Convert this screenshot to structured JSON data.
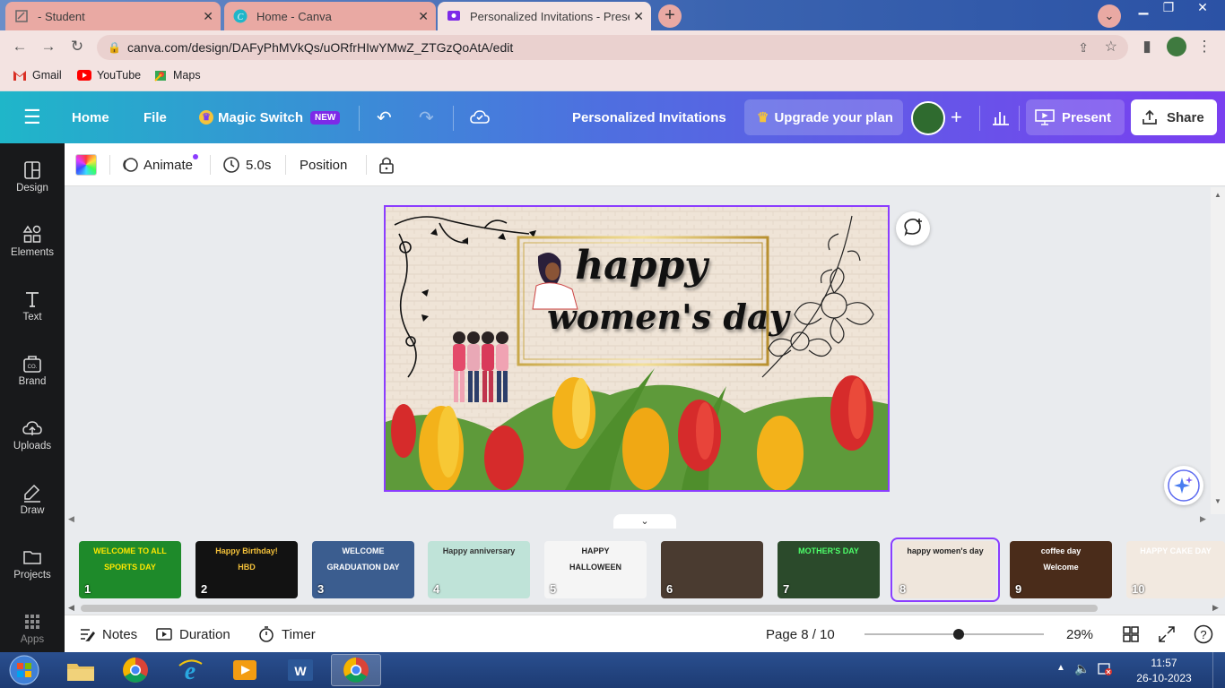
{
  "browser": {
    "tabs": [
      {
        "title": "- Student",
        "active": false
      },
      {
        "title": "Home - Canva",
        "active": false
      },
      {
        "title": "Personalized Invitations - Present",
        "active": true
      }
    ],
    "new_tab": "+",
    "url": "canva.com/design/DAFyPhMVkQs/uORfrHIwYMwZ_ZTGzQoAtA/edit",
    "bookmarks": [
      "Gmail",
      "YouTube",
      "Maps"
    ]
  },
  "header": {
    "home": "Home",
    "file": "File",
    "magic_switch": "Magic Switch",
    "magic_badge": "NEW",
    "doc_title": "Personalized Invitations",
    "upgrade": "Upgrade your plan",
    "present": "Present",
    "share": "Share"
  },
  "rail": [
    {
      "label": "Design",
      "icon": "layout-icon"
    },
    {
      "label": "Elements",
      "icon": "shapes-icon"
    },
    {
      "label": "Text",
      "icon": "text-icon"
    },
    {
      "label": "Brand",
      "icon": "brand-icon"
    },
    {
      "label": "Uploads",
      "icon": "cloud-upload-icon"
    },
    {
      "label": "Draw",
      "icon": "pen-icon"
    },
    {
      "label": "Projects",
      "icon": "folder-icon"
    },
    {
      "label": "Apps",
      "icon": "grid-icon"
    }
  ],
  "context_toolbar": {
    "animate": "Animate",
    "duration": "5.0s",
    "position": "Position"
  },
  "slide": {
    "line1": "happy",
    "line2": "women's day"
  },
  "filmstrip": [
    {
      "num": "1",
      "text": "WELCOME TO ALL",
      "sub": "SPORTS DAY",
      "bg": "#1e8a2a",
      "fg": "#ffe600"
    },
    {
      "num": "2",
      "text": "Happy Birthday!",
      "sub": "HBD",
      "bg": "#121212",
      "fg": "#f3c13a"
    },
    {
      "num": "3",
      "text": "WELCOME",
      "sub": "GRADUATION DAY",
      "bg": "#3b5d8f",
      "fg": "#ffffff"
    },
    {
      "num": "4",
      "text": "Happy anniversary",
      "sub": "",
      "bg": "#bfe3d8",
      "fg": "#333333"
    },
    {
      "num": "5",
      "text": "HAPPY",
      "sub": "HALLOWEEN",
      "bg": "#f5f5f5",
      "fg": "#222222"
    },
    {
      "num": "6",
      "text": "",
      "sub": "",
      "bg": "#4a3b30",
      "fg": "#ffffff"
    },
    {
      "num": "7",
      "text": "MOTHER'S DAY",
      "sub": "",
      "bg": "#2b4a2b",
      "fg": "#4dff6a"
    },
    {
      "num": "8",
      "text": "happy women's day",
      "sub": "",
      "bg": "#efe6dc",
      "fg": "#222222"
    },
    {
      "num": "9",
      "text": "coffee day",
      "sub": "Welcome",
      "bg": "#4a2c1a",
      "fg": "#ffffff"
    },
    {
      "num": "10",
      "text": "HAPPY CAKE DAY",
      "sub": "",
      "bg": "#f2e9e0",
      "fg": "#ffffff"
    }
  ],
  "footer": {
    "notes": "Notes",
    "duration": "Duration",
    "timer": "Timer",
    "page": "Page 8 / 10",
    "zoom_value": 0.29,
    "zoom": "29%"
  },
  "taskbar": {
    "time": "11:57",
    "date": "26-10-2023"
  },
  "colors": {
    "accent": "#8b3dff",
    "header_gradient_start": "#1fb6c9",
    "header_gradient_end": "#7a3ff0"
  }
}
